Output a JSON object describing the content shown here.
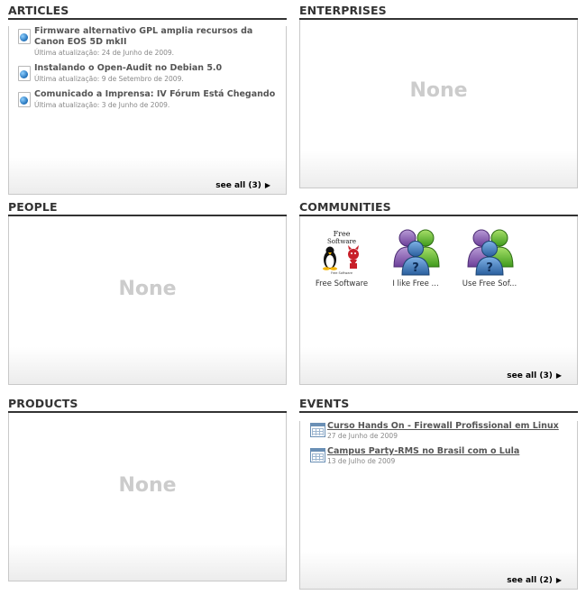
{
  "articles": {
    "title": "Articles",
    "items": [
      {
        "title": "Firmware alternativo GPL amplia recursos da Canon EOS 5D mkII",
        "date": "Última atualização: 24 de Junho de 2009."
      },
      {
        "title": "Instalando o Open-Audit no Debian 5.0",
        "date": "Última atualização: 9 de Setembro de 2009."
      },
      {
        "title": "Comunicado a Imprensa: IV Fórum Está Chegando",
        "date": "Última atualização: 3 de Junho de 2009."
      }
    ],
    "see_all": "see all (3)"
  },
  "enterprises": {
    "title": "Enterprises",
    "empty": "None"
  },
  "people": {
    "title": "People",
    "empty": "None"
  },
  "communities": {
    "title": "Communities",
    "items": [
      {
        "label": "Free Software",
        "icon": "free-software-logo"
      },
      {
        "label": "I like Free ...",
        "icon": "community-people-icon"
      },
      {
        "label": "Use Free Sof...",
        "icon": "community-people-icon"
      }
    ],
    "see_all": "see all (3)"
  },
  "products": {
    "title": "Products",
    "empty": "None"
  },
  "events": {
    "title": "Events",
    "items": [
      {
        "title": "Curso Hands On - Firewall Profissional em Linux",
        "date": "27 de Junho de 2009"
      },
      {
        "title": "Campus Party-RMS no Brasil com o Lula",
        "date": "13 de Julho de 2009"
      }
    ],
    "see_all": "see all (2)"
  },
  "colors": {
    "heading": "#333333",
    "empty_text": "#cccccc",
    "border": "#c9c9c9"
  }
}
